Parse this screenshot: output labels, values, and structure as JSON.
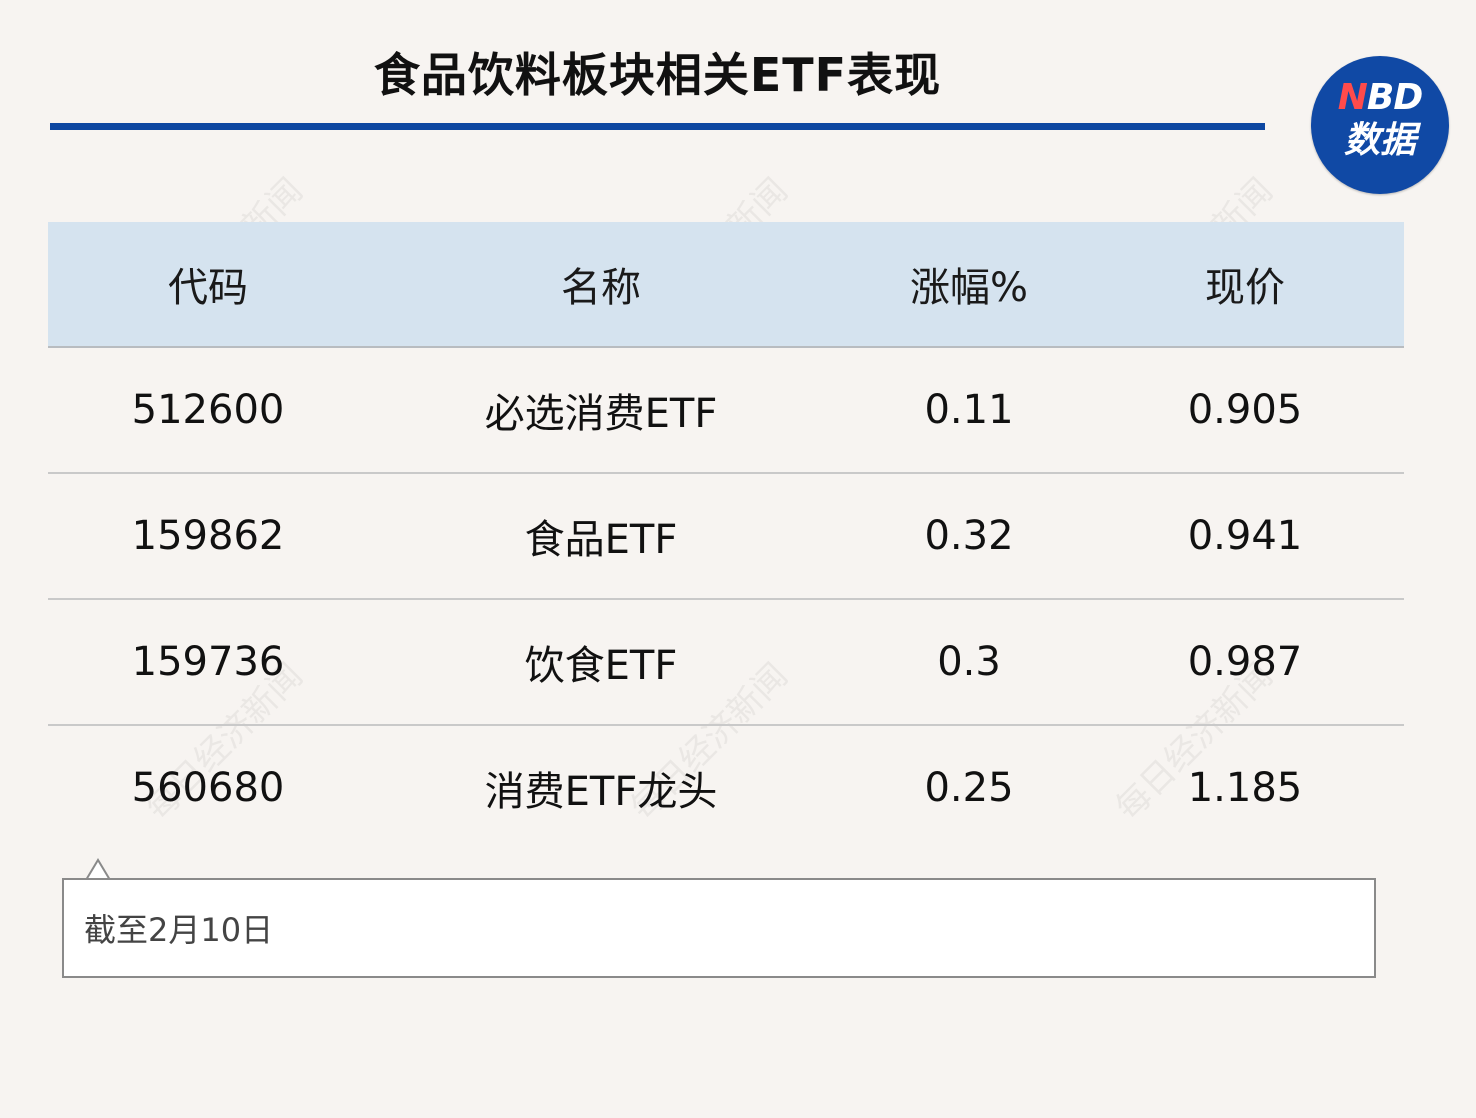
{
  "title": "食品饮料板块相关ETF表现",
  "logo": {
    "line1_n": "N",
    "line1_rest": "BD",
    "line2": "数据"
  },
  "watermark_text": "每日经济新闻",
  "chart_data": {
    "type": "table",
    "title": "食品饮料板块相关ETF表现",
    "columns": [
      "代码",
      "名称",
      "涨幅%",
      "现价"
    ],
    "rows": [
      {
        "code": "512600",
        "name": "必选消费ETF",
        "change_pct": "0.11",
        "price": "0.905"
      },
      {
        "code": "159862",
        "name": "食品ETF",
        "change_pct": "0.32",
        "price": "0.941"
      },
      {
        "code": "159736",
        "name": "饮食ETF",
        "change_pct": "0.3",
        "price": "0.987"
      },
      {
        "code": "560680",
        "name": "消费ETF龙头",
        "change_pct": "0.25",
        "price": "1.185"
      }
    ]
  },
  "note": "截至2月10日",
  "colors": {
    "header_bg": "#d5e3ef",
    "title_rule": "#0d47a1",
    "logo_bg": "#1049a5",
    "logo_accent": "#ff4b4b",
    "page_bg": "#f7f4f1"
  }
}
